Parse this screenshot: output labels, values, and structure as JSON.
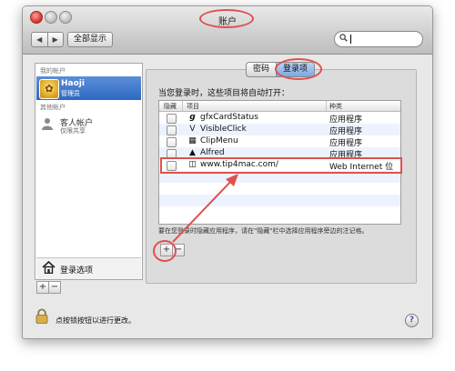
{
  "window": {
    "title": "账户"
  },
  "toolbar": {
    "back": "◀",
    "forward": "▶",
    "show_all": "全部显示"
  },
  "search": {
    "value": "",
    "icon": "search-icon"
  },
  "sidebar": {
    "my_accounts_header": "我的帐户",
    "current_user": {
      "name": "Haoji",
      "role": "管理员"
    },
    "other_accounts_header": "其他帐户",
    "guest": {
      "name": "客人帐户",
      "sub": "仅限共享"
    },
    "login_options": "登录选项",
    "add": "+",
    "remove": "−"
  },
  "tabs": [
    {
      "label": "密码",
      "active": false
    },
    {
      "label": "登录项",
      "active": true
    }
  ],
  "prompt": "当您登录时，这些项目将自动打开：",
  "table": {
    "columns": [
      "隐藏",
      "项目",
      "种类"
    ],
    "rows": [
      {
        "checked": false,
        "icon": "g",
        "name": "gfxCardStatus",
        "kind": "应用程序"
      },
      {
        "checked": false,
        "icon": "V",
        "name": "VisibleClick",
        "kind": "应用程序"
      },
      {
        "checked": false,
        "icon": "▦",
        "name": "ClipMenu",
        "kind": "应用程序"
      },
      {
        "checked": false,
        "icon": "▲",
        "name": "Alfred",
        "kind": "应用程序"
      },
      {
        "checked": false,
        "icon": "◫",
        "name": "www.tip4mac.com/",
        "kind": "Web Internet 位置"
      }
    ]
  },
  "hint": "要在您登录时隐藏应用程序，请在\"隐藏\"栏中选择应用程序旁边的注记格。",
  "table_add": "+",
  "table_remove": "−",
  "lock_label": "点按锁按钮以进行更改。",
  "help": "?"
}
